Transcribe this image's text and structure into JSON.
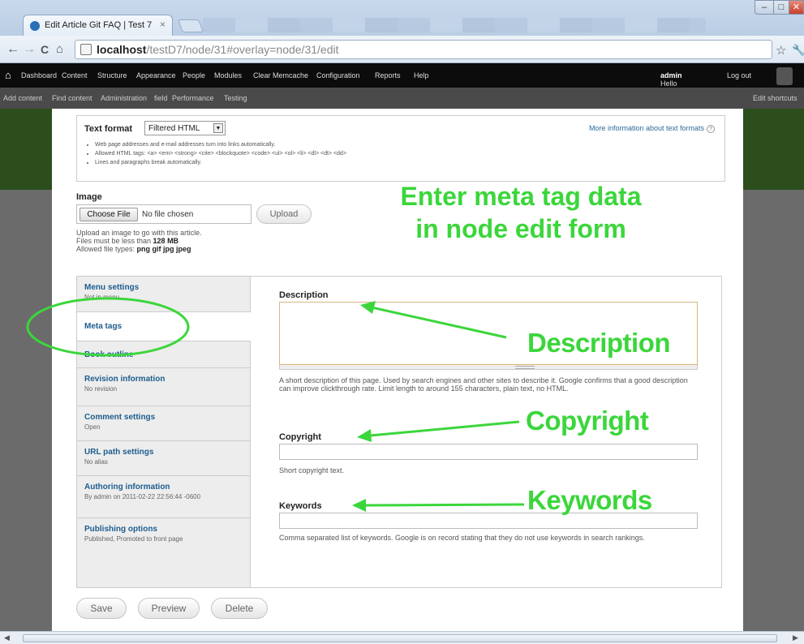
{
  "browser": {
    "tab_title": "Edit Article Git FAQ | Test 7",
    "tab_close": "×",
    "url_host": "localhost",
    "url_path": "/testD7/node/31#overlay=node/31/edit",
    "back": "←",
    "forward": "→",
    "reload": "C",
    "home": "⌂",
    "star": "☆",
    "wrench": "🔧",
    "min": "–",
    "max": "□",
    "close": "✕"
  },
  "drupal_toolbar": {
    "home": "⌂",
    "items": [
      "Dashboard",
      "Content",
      "Structure",
      "Appearance",
      "People",
      "Modules",
      "Clear Memcache",
      "Configuration",
      "Reports",
      "Help"
    ],
    "hello": "Hello ",
    "user": "admin",
    "logout": "Log out"
  },
  "shortcuts": {
    "items": [
      "Add content",
      "Find content",
      "Administration",
      "field",
      "Performance",
      "Testing"
    ],
    "edit": "Edit shortcuts"
  },
  "text_format": {
    "label": "Text format",
    "selected": "Filtered HTML",
    "more_info": "More information about text formats",
    "tips": [
      "Web page addresses and e-mail addresses turn into links automatically.",
      "Allowed HTML tags: <a> <em> <strong> <cite> <blockquote> <code> <ul> <ol> <li> <dl> <dt> <dd>",
      "Lines and paragraphs break automatically."
    ]
  },
  "image": {
    "label": "Image",
    "choose": "Choose File",
    "no_file": "No file chosen",
    "upload": "Upload",
    "help1": "Upload an image to go with this article.",
    "help2a": "Files must be less than ",
    "help2b": "128 MB",
    "help3a": "Allowed file types: ",
    "help3b": "png gif jpg jpeg"
  },
  "annotation": {
    "title_line1": "Enter meta tag data",
    "title_line2": "in node edit form",
    "description": "Description",
    "copyright": "Copyright",
    "keywords": "Keywords"
  },
  "vertical_tabs": [
    {
      "title": "Menu settings",
      "summary": "Not in menu"
    },
    {
      "title": "Meta tags",
      "summary": ""
    },
    {
      "title": "Book outline",
      "summary": ""
    },
    {
      "title": "Revision information",
      "summary": "No revision"
    },
    {
      "title": "Comment settings",
      "summary": "Open"
    },
    {
      "title": "URL path settings",
      "summary": "No alias"
    },
    {
      "title": "Authoring information",
      "summary": "By admin on 2011-02-22 22:56:44 -0600"
    },
    {
      "title": "Publishing options",
      "summary": "Published, Promoted to front page"
    }
  ],
  "meta": {
    "description_label": "Description",
    "description_help": "A short description of this page. Used by search engines and other sites to describe it. Google confirms that a good description can improve clickthrough rate. Limit length to around 155 characters, plain text, no HTML.",
    "copyright_label": "Copyright",
    "copyright_help": "Short copyright text.",
    "keywords_label": "Keywords",
    "keywords_help": "Comma separated list of keywords. Google is on record stating that they do not use keywords in search rankings."
  },
  "actions": {
    "save": "Save",
    "preview": "Preview",
    "delete": "Delete"
  },
  "colors": {
    "annotation": "#3bd63b",
    "link": "#1d5d8e",
    "toolbar": "#0c0c0c"
  }
}
